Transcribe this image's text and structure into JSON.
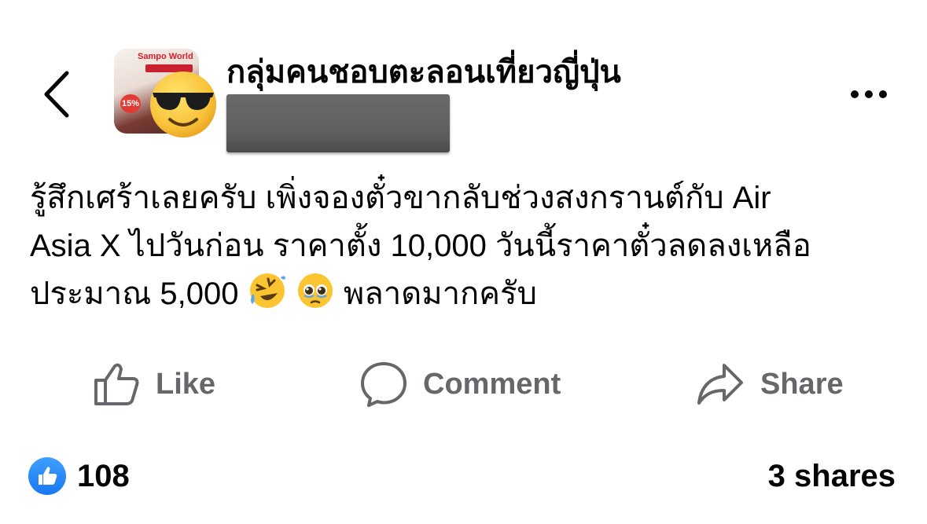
{
  "header": {
    "back_icon": "chevron-left-icon",
    "group_name": "กลุ่มคนชอบตะลอนเที่ยวญี่ปุ่น",
    "avatar_ad_text": "Sampo World",
    "avatar_ad_badge": "15%",
    "avatar_overlay_icon": "sunglasses-emoji-icon",
    "author_redacted": true,
    "more_icon": "more-horizontal-icon"
  },
  "post": {
    "lines": [
      "รู้สึกเศร้าเลยครับ เพิ่งจองตั๋วขากลับช่วงสงกรานต์กับ Air",
      "Asia X ไปวันก่อน ราคาตั้ง 10,000 วันนี้ราคาตั๋วลดลงเหลือ",
      "ประมาณ 5,000"
    ],
    "emoji_1": "rolling-on-floor-laughing-emoji-icon",
    "emoji_2": "pleading-face-emoji-icon",
    "tail_text": "พลาดมากครับ"
  },
  "actions": {
    "like_label": "Like",
    "comment_label": "Comment",
    "share_label": "Share"
  },
  "stats": {
    "reaction_count": "108",
    "shares": "3 shares"
  },
  "colors": {
    "text": "#050505",
    "muted": "#65676b",
    "accent_blue": "#1877f2"
  }
}
